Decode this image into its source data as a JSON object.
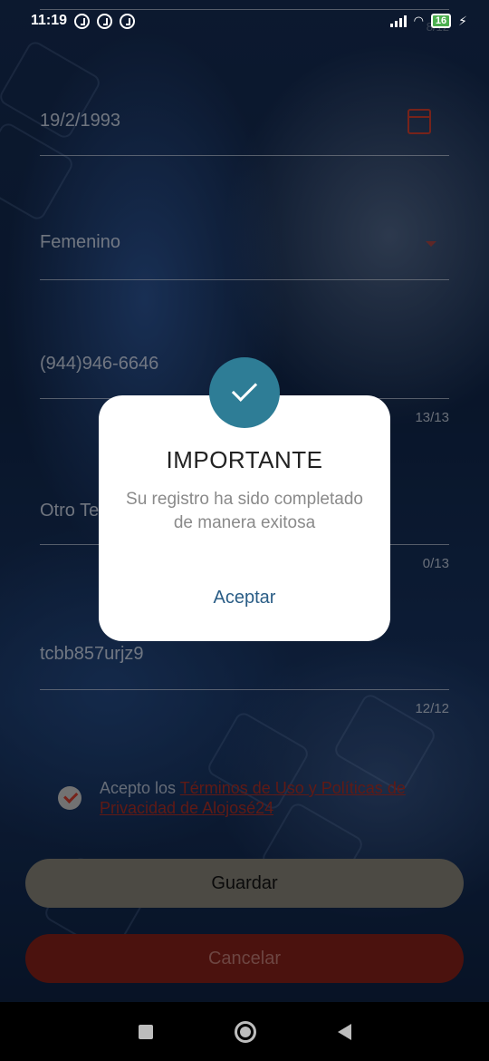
{
  "status_bar": {
    "time": "11:19",
    "battery": "16",
    "charging_icon": "⚡"
  },
  "form": {
    "top_counter": "8/12",
    "birthdate": {
      "value": "19/2/1993",
      "icon": "calendar-icon"
    },
    "gender": {
      "value": "Femenino"
    },
    "phone": {
      "value": "(944)946-6646",
      "counter": "13/13"
    },
    "other_phone": {
      "placeholder": "Otro Te",
      "counter": "0/13"
    },
    "password": {
      "value": "tcbb857urjz9",
      "counter": "12/12"
    },
    "terms": {
      "prefix": "Acepto los ",
      "link": "Términos de Uso y Políticas de Privacidad de Alojosé24",
      "checked": true
    },
    "save_label": "Guardar",
    "cancel_label": "Cancelar"
  },
  "dialog": {
    "title": "IMPORTANTE",
    "message": "Su registro ha sido completado de manera exitosa",
    "accept_label": "Aceptar",
    "badge_icon": "check-icon",
    "badge_color": "#2e7d96"
  },
  "colors": {
    "accent_red": "#c0392b",
    "link_blue": "#2a5d86"
  }
}
